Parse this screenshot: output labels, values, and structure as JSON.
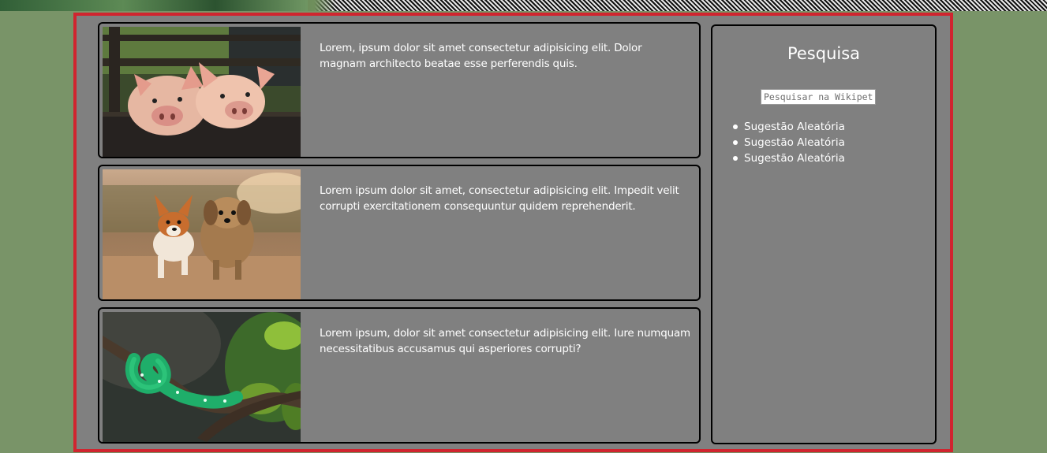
{
  "articles": [
    {
      "image": "pigs-photo",
      "text": "Lorem, ipsum dolor sit amet consectetur adipisicing elit. Dolor magnam architecto beatae esse perferendis quis."
    },
    {
      "image": "dogs-photo",
      "text": "Lorem ipsum dolor sit amet, consectetur adipisicing elit. Impedit velit corrupti exercitationem consequuntur quidem reprehenderit."
    },
    {
      "image": "snake-photo",
      "text": "Lorem ipsum, dolor sit amet consectetur adipisicing elit. Iure numquam necessitatibus accusamus qui asperiores corrupti?"
    }
  ],
  "sidebar": {
    "title": "Pesquisa",
    "search": {
      "placeholder": "Pesquisar na Wikipet",
      "value": ""
    },
    "suggestions": [
      "Sugestão Aleatória",
      "Sugestão Aleatória",
      "Sugestão Aleatória"
    ]
  },
  "colors": {
    "page_background": "#799468",
    "frame_border": "#d0252f",
    "panel_background": "#808080",
    "text": "#ffffff"
  }
}
